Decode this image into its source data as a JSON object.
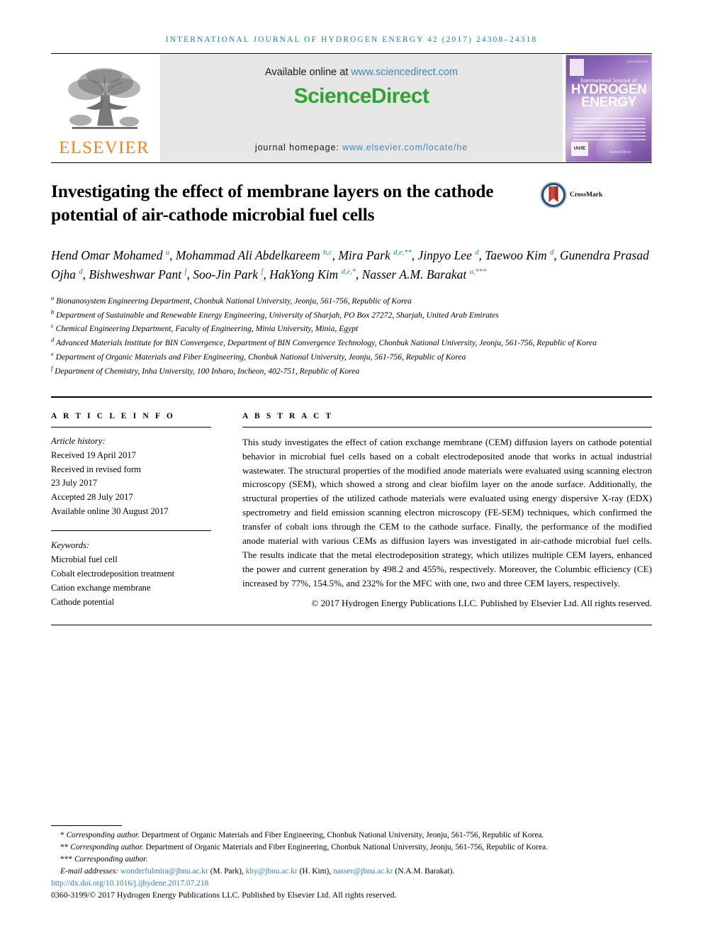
{
  "running_head": "International Journal of Hydrogen Energy 42 (2017) 24308–24318",
  "masthead": {
    "publisher_name": "ELSEVIER",
    "available_prefix": "Available online at ",
    "available_url": "www.sciencedirect.com",
    "sciencedirect_logo": "ScienceDirect",
    "homepage_prefix": "journal homepage: ",
    "homepage_url": "www.elsevier.com/locate/he",
    "cover": {
      "line1": "International Journal of",
      "line2": "HYDROGEN",
      "line3": "ENERGY",
      "issn": "ISSN 0360-3199",
      "badge": "IAHE",
      "footer": "ScienceDirect"
    }
  },
  "title": "Investigating the effect of membrane layers on the cathode potential of air-cathode microbial fuel cells",
  "crossmark_label": "CrossMark",
  "authors_html": "Hend Omar Mohamed <sup>a</sup>, Mohammad Ali Abdelkareem <sup>b,c</sup>, Mira Park <sup>d,e,**</sup>, Jinpyo Lee <sup>d</sup>, Taewoo Kim <sup>d</sup>, Gunendra Prasad Ojha <sup>d</sup>, Bishweshwar Pant <sup>f</sup>, Soo-Jin Park <sup>f</sup>, HakYong Kim <sup>d,e,*</sup>, Nasser A.M. Barakat <sup>a,***</sup>",
  "affiliations": [
    {
      "mark": "a",
      "text": "Bionanosystem Engineering Department, Chonbuk National University, Jeonju, 561-756, Republic of Korea"
    },
    {
      "mark": "b",
      "text": "Department of Sustainable and Renewable Energy Engineering, University of Sharjah, PO Box 27272, Sharjah, United Arab Emirates"
    },
    {
      "mark": "c",
      "text": "Chemical Engineering Department, Faculty of Engineering, Minia University, Minia, Egypt"
    },
    {
      "mark": "d",
      "text": "Advanced Materials Institute for BIN Convergence, Department of BIN Convergence Technology, Chonbuk National University, Jeonju, 561-756, Republic of Korea"
    },
    {
      "mark": "e",
      "text": "Department of Organic Materials and Fiber Engineering, Chonbuk National University, Jeonju, 561-756, Republic of Korea"
    },
    {
      "mark": "f",
      "text": "Department of Chemistry, Inha University, 100 Inharo, Incheon, 402-751, Republic of Korea"
    }
  ],
  "article_info": {
    "heading": "A R T I C L E   I N F O",
    "history_label": "Article history:",
    "history": [
      "Received 19 April 2017",
      "Received in revised form",
      "23 July 2017",
      "Accepted 28 July 2017",
      "Available online 30 August 2017"
    ],
    "keywords_label": "Keywords:",
    "keywords": [
      "Microbial fuel cell",
      "Cobalt electrodeposition treatment",
      "Cation exchange membrane",
      "Cathode potential"
    ]
  },
  "abstract": {
    "heading": "A B S T R A C T",
    "body": "This study investigates the effect of cation exchange membrane (CEM) diffusion layers on cathode potential behavior in microbial fuel cells based on a cobalt electrodeposited anode that works in actual industrial wastewater. The structural properties of the modified anode materials were evaluated using scanning electron microscopy (SEM), which showed a strong and clear biofilm layer on the anode surface. Additionally, the structural properties of the utilized cathode materials were evaluated using energy dispersive X-ray (EDX) spectrometry and field emission scanning electron microscopy (FE-SEM) techniques, which confirmed the transfer of cobalt ions through the CEM to the cathode surface. Finally, the performance of the modified anode material with various CEMs as diffusion layers was investigated in air-cathode microbial fuel cells. The results indicate that the metal electrodeposition strategy, which utilizes multiple CEM layers, enhanced the power and current generation by 498.2 and 455%, respectively. Moreover, the Columbic efficiency (CE) increased by 77%, 154.5%, and 232% for the MFC with one, two and three CEM layers, respectively.",
    "copyright": "© 2017 Hydrogen Energy Publications LLC. Published by Elsevier Ltd. All rights reserved."
  },
  "footnotes": {
    "note1_mark": "*",
    "note1_label": "Corresponding author.",
    "note1_text": " Department of Organic Materials and Fiber Engineering, Chonbuk National University, Jeonju, 561-756, Republic of Korea.",
    "note2_mark": "**",
    "note2_label": "Corresponding author.",
    "note2_text": " Department of Organic Materials and Fiber Engineering, Chonbuk National University, Jeonju, 561-756, Republic of Korea.",
    "note3_mark": "***",
    "note3_label": "Corresponding author.",
    "email_label": "E-mail addresses:",
    "emails": [
      {
        "address": "wonderfulmira@jbnu.ac.kr",
        "person": "(M. Park)"
      },
      {
        "address": "khy@jbnu.ac.kr",
        "person": "(H. Kim)"
      },
      {
        "address": "nasser@jbnu.ac.kr",
        "person": "(N.A.M. Barakat)"
      }
    ],
    "doi": "http://dx.doi.org/10.1016/j.ijhydene.2017.07.218",
    "issn_line": "0360-3199/© 2017 Hydrogen Energy Publications LLC. Published by Elsevier Ltd. All rights reserved."
  },
  "colors": {
    "journal_blue": "#1a7fa8",
    "link_blue": "#2f7fb5",
    "sciencedirect_green": "#2ea52e",
    "elsevier_orange": "#f08420"
  }
}
